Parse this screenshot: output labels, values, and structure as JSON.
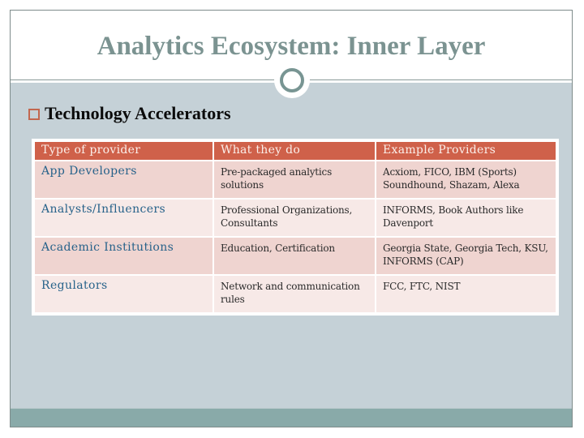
{
  "slide": {
    "title": "Analytics Ecosystem: Inner Layer",
    "bullet": {
      "icon": "hollow-square-bullet",
      "text": "Technology Accelerators"
    },
    "colors": {
      "title": "#7b9391",
      "body_band": "#c5d1d7",
      "footer_band": "#89aaa9",
      "table_header": "#cf614a",
      "row_odd": "#efd4d0",
      "row_even": "#f7e9e7",
      "provider_text": "#27628a",
      "bullet_box": "#c2674f"
    }
  },
  "table": {
    "headers": [
      "Type of provider",
      "What they do",
      "Example Providers"
    ],
    "rows": [
      {
        "type": "App Developers",
        "what": "Pre-packaged analytics solutions",
        "examples": "Acxiom, FICO, IBM (Sports) Soundhound, Shazam, Alexa"
      },
      {
        "type": "Analysts/Influencers",
        "what": "Professional Organizations, Consultants",
        "examples": "INFORMS, Book Authors like Davenport"
      },
      {
        "type": "Academic Institutions",
        "what": "Education, Certification",
        "examples": "Georgia State, Georgia Tech, KSU, INFORMS (CAP)"
      },
      {
        "type": "Regulators",
        "what": "Network and communication rules",
        "examples": "FCC, FTC, NIST"
      }
    ]
  }
}
